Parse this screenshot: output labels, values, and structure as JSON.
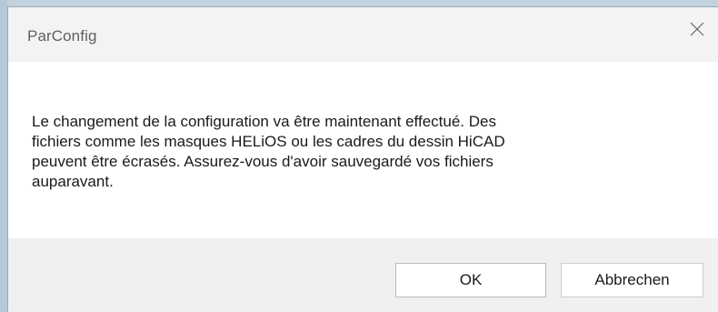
{
  "window": {
    "title": "ParConfig",
    "close_icon": "close-icon"
  },
  "message": {
    "text": "Le changement de la configuration va être maintenant effectué. Des\nfichiers comme les masques HELiOS ou les cadres du dessin HiCAD\npeuvent être écrasés. Assurez-vous d'avoir sauvegardé vos fichiers\nauparavant."
  },
  "buttons": {
    "ok_label": "OK",
    "cancel_label": "Abbrechen"
  },
  "colors": {
    "title_bar": "#f3f3f3",
    "footer": "#f0f0f0",
    "content": "#ffffff",
    "desktop": "#b3c7d6"
  }
}
